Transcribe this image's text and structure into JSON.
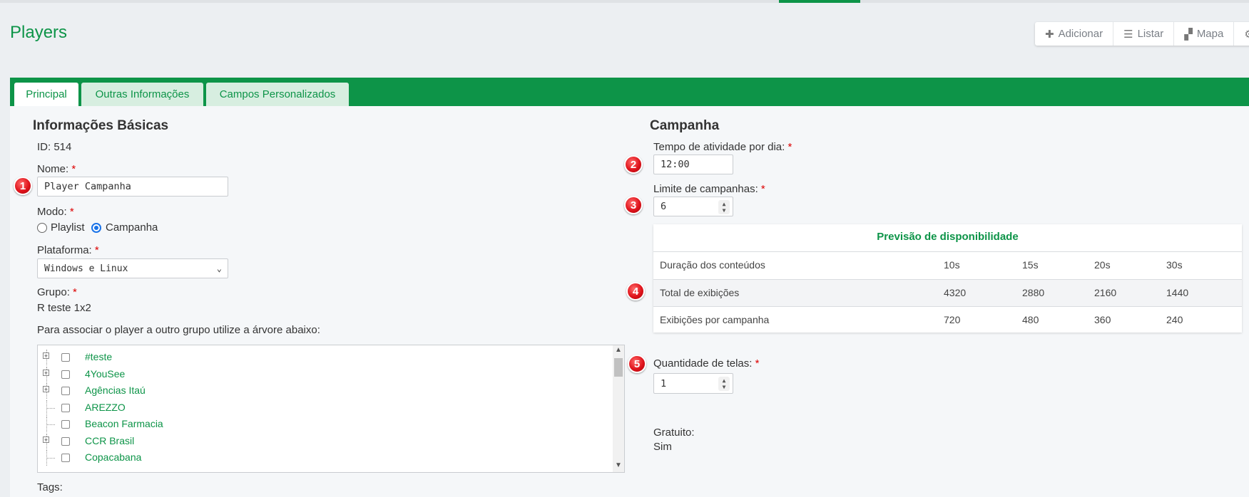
{
  "header": {
    "title": "Players",
    "toolbar": [
      {
        "icon": "plus-icon",
        "glyph": "✚",
        "label": "Adicionar"
      },
      {
        "icon": "list-icon",
        "glyph": "☰",
        "label": "Listar"
      },
      {
        "icon": "map-icon",
        "glyph": "▞",
        "label": "Mapa"
      },
      {
        "icon": "gear-icon",
        "glyph": "⚙",
        "label": ""
      }
    ]
  },
  "tabs": [
    {
      "label": "Principal",
      "active": true
    },
    {
      "label": "Outras Informações",
      "active": false
    },
    {
      "label": "Campos Personalizados",
      "active": false
    }
  ],
  "basic": {
    "heading": "Informações Básicas",
    "id_text": "ID: 514",
    "name_label": "Nome:",
    "name_value": "Player Campanha",
    "mode_label": "Modo:",
    "mode_options": [
      "Playlist",
      "Campanha"
    ],
    "mode_selected": "Campanha",
    "platform_label": "Plataforma:",
    "platform_value": "Windows e Linux",
    "group_label": "Grupo:",
    "group_value": "R teste 1x2",
    "tree_hint": "Para associar o player a outro grupo utilize a árvore abaixo:",
    "tree_items": [
      {
        "name": "#teste",
        "expandable": true
      },
      {
        "name": "4YouSee",
        "expandable": true
      },
      {
        "name": "Agências Itaú",
        "expandable": true
      },
      {
        "name": "AREZZO",
        "expandable": false
      },
      {
        "name": "Beacon Farmacia",
        "expandable": false
      },
      {
        "name": "CCR Brasil",
        "expandable": true
      },
      {
        "name": "Copacabana",
        "expandable": false
      }
    ],
    "tags_label": "Tags:"
  },
  "campaign": {
    "heading": "Campanha",
    "uptime_label": "Tempo de atividade por dia:",
    "uptime_value": "12:00",
    "limit_label": "Limite de campanhas:",
    "limit_value": "6",
    "forecast": {
      "title": "Previsão de disponibilidade",
      "rows": [
        [
          "Duração dos conteúdos",
          "10s",
          "15s",
          "20s",
          "30s"
        ],
        [
          "Total de exibições",
          "4320",
          "2880",
          "2160",
          "1440"
        ],
        [
          "Exibições por campanha",
          "720",
          "480",
          "360",
          "240"
        ]
      ]
    },
    "screens_label": "Quantidade de telas:",
    "screens_value": "1",
    "free_label": "Gratuito:",
    "free_value": "Sim"
  },
  "required_mark": "*",
  "badges": [
    "1",
    "2",
    "3",
    "4",
    "5"
  ],
  "colors": {
    "brand": "#0d9448",
    "required": "#dd0000",
    "badge": "#e0141c"
  }
}
